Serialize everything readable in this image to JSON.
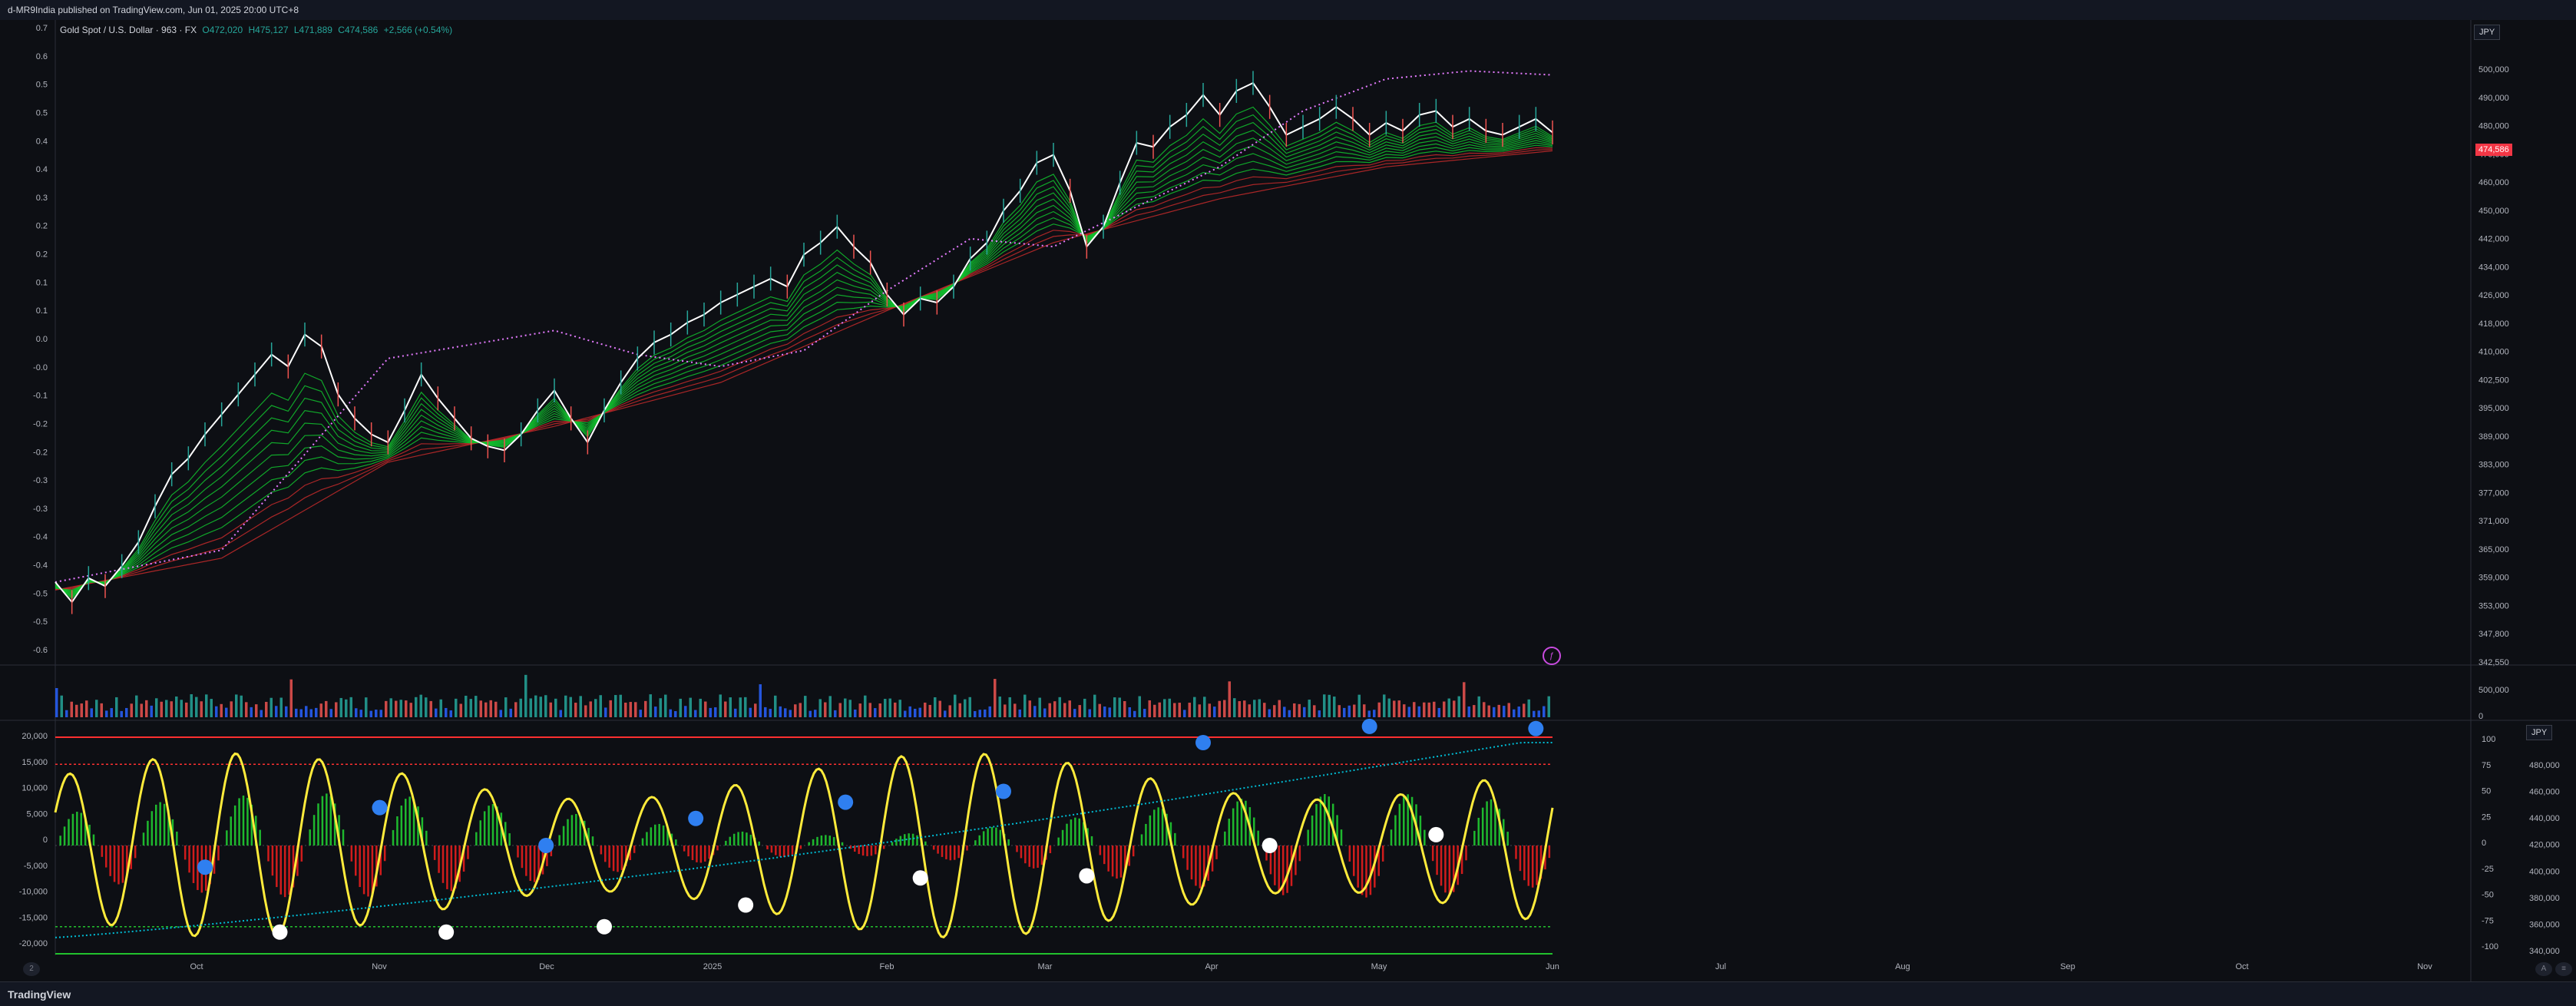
{
  "header": {
    "published_text": "d-MR9India published on TradingView.com, Jun 01, 2025 20:00 UTC+8"
  },
  "legend": {
    "symbol": "Gold Spot / U.S. Dollar · 963 · FX",
    "open": "O472,020",
    "high": "H475,127",
    "low": "L471,889",
    "close": "C474,586",
    "change": "+2,566 (+0.54%)"
  },
  "currency_main": "JPY",
  "currency_osc": "JPY",
  "last_price": "474,586",
  "footer": {
    "brand": "TradingView"
  },
  "corner_labels": {
    "bottom_left": "2",
    "bottom_right_a": "A",
    "bottom_right_b": "≡"
  },
  "colors": {
    "background": "#0d0f14",
    "price_line": "#ffffff",
    "ribbon_green": "#12c22e",
    "ribbon_red": "#c42a2a",
    "purple_dots": "#e57bff",
    "osc_yellow": "#ffeb3b",
    "histogram_green": "#1eb82e",
    "histogram_red": "#d01c1c",
    "upper_band": "#ff3030",
    "lower_band": "#22c22e",
    "cyan_signal": "#00bcd4",
    "marker_blue": "#2f7ff0",
    "marker_white": "#ffffff"
  },
  "chart_data": [
    {
      "type": "line",
      "title": "Gold Spot / U.S. Dollar",
      "left_axis_ticks": [
        "0.7",
        "0.6",
        "0.5",
        "0.5",
        "0.4",
        "0.4",
        "0.3",
        "0.2",
        "0.2",
        "0.1",
        "0.1",
        "0.0",
        "-0.0",
        "-0.1",
        "-0.2",
        "-0.2",
        "-0.3",
        "-0.3",
        "-0.4",
        "-0.4",
        "-0.5",
        "-0.5",
        "-0.6"
      ],
      "right_axis_ticks": [
        "500,000",
        "490,000",
        "480,000",
        "470,000",
        "460,000",
        "450,000",
        "442,000",
        "434,000",
        "426,000",
        "418,000",
        "410,000",
        "402,500",
        "395,000",
        "389,000",
        "383,000",
        "377,000",
        "371,000",
        "365,000",
        "359,000",
        "353,000",
        "347,800",
        "342,550"
      ],
      "x_ticks": [
        "Oct",
        "Nov",
        "Dec",
        "2025",
        "Feb",
        "Mar",
        "Apr",
        "May",
        "Jun",
        "Jul",
        "Aug",
        "Sep",
        "Oct",
        "Nov"
      ],
      "series": [
        {
          "name": "price",
          "x": [
            0,
            2,
            4,
            6,
            8,
            10,
            12,
            14,
            16,
            18,
            20,
            22,
            24,
            26,
            28,
            30,
            32,
            34,
            36,
            38,
            40,
            42,
            44,
            46,
            48,
            50,
            52,
            54,
            56,
            58,
            60,
            62,
            64,
            66,
            68,
            70,
            72,
            74,
            76,
            78,
            80,
            82,
            84,
            86,
            88,
            90,
            92,
            94,
            96,
            98,
            100,
            102,
            104,
            106,
            108,
            110,
            112,
            114,
            116,
            118,
            120,
            122,
            124,
            126,
            128,
            130,
            132,
            134,
            136,
            138,
            140,
            142,
            144,
            146,
            148,
            150,
            152,
            154,
            156,
            158,
            160,
            162,
            164,
            166,
            168,
            170,
            172,
            174,
            176,
            178,
            180
          ],
          "values": [
            362,
            357,
            363,
            361,
            366,
            372,
            381,
            389,
            393,
            399,
            404,
            409,
            414,
            419,
            416,
            424,
            421,
            409,
            403,
            399,
            397,
            405,
            414,
            408,
            403,
            398,
            396,
            395,
            399,
            405,
            410,
            403,
            397,
            405,
            412,
            418,
            422,
            424,
            427,
            429,
            432,
            434,
            436,
            438,
            436,
            444,
            447,
            451,
            446,
            442,
            434,
            429,
            433,
            432,
            436,
            443,
            447,
            455,
            460,
            467,
            469,
            460,
            446,
            451,
            462,
            472,
            471,
            476,
            479,
            484,
            479,
            485,
            487,
            481,
            474,
            476,
            478,
            481,
            478,
            474,
            477,
            475,
            479,
            480,
            476,
            478,
            475,
            474,
            476,
            478,
            474.6
          ]
        },
        {
          "name": "ribbon_slow",
          "x": [
            0,
            20,
            40,
            60,
            80,
            100,
            120,
            140,
            160,
            180
          ],
          "values": [
            360,
            368,
            392,
            401,
            412,
            430,
            447,
            458,
            466,
            470
          ]
        },
        {
          "name": "purple_upper",
          "x": [
            0,
            20,
            40,
            60,
            70,
            80,
            90,
            100,
            110,
            120,
            130,
            140,
            150,
            160,
            170,
            180
          ],
          "values": [
            362,
            370,
            418,
            425,
            419,
            416,
            420,
            435,
            448,
            446,
            456,
            466,
            480,
            488,
            490,
            489
          ]
        }
      ]
    },
    {
      "type": "bar",
      "title": "Volume",
      "axis_ticks": [
        "500,000",
        "0"
      ]
    },
    {
      "type": "line",
      "title": "Oscillator",
      "left_axis_ticks": [
        "20,000",
        "15,000",
        "10,000",
        "5,000",
        "0",
        "-5,000",
        "-10,000",
        "-15,000",
        "-20,000"
      ],
      "mid_axis_ticks": [
        "100",
        "75",
        "50",
        "25",
        "0",
        "-25",
        "-50",
        "-75",
        "-100"
      ],
      "right_axis_ticks": [
        "480,000",
        "460,000",
        "440,000",
        "420,000",
        "400,000",
        "380,000",
        "360,000",
        "340,000"
      ],
      "upper_band": 100,
      "upper_dotted": 75,
      "lower_dotted": -75,
      "lower_band": -100,
      "blue_markers": [
        [
          18,
          -20
        ],
        [
          39,
          35
        ],
        [
          59,
          0
        ],
        [
          77,
          25
        ],
        [
          95,
          40
        ],
        [
          114,
          50
        ],
        [
          138,
          95
        ],
        [
          158,
          110
        ],
        [
          178,
          108
        ]
      ],
      "white_markers": [
        [
          27,
          -80
        ],
        [
          47,
          -80
        ],
        [
          66,
          -75
        ],
        [
          83,
          -55
        ],
        [
          104,
          -30
        ],
        [
          124,
          -28
        ],
        [
          146,
          0
        ],
        [
          166,
          10
        ]
      ]
    }
  ]
}
